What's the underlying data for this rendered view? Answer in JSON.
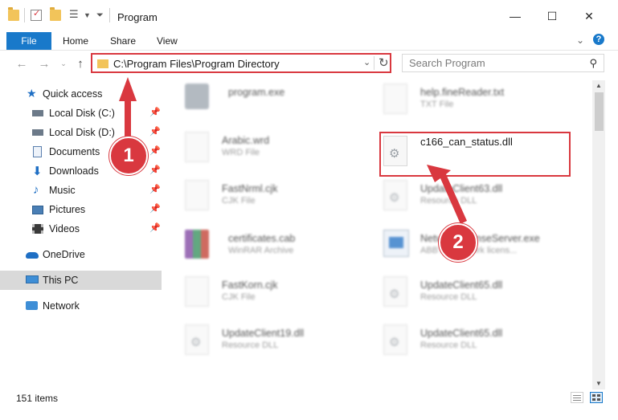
{
  "window": {
    "title": "Program",
    "minimize": "—",
    "maximize": "☐",
    "close": "✕"
  },
  "ribbon": {
    "tabs": [
      "File",
      "Home",
      "Share",
      "View"
    ]
  },
  "address": {
    "path": "C:\\Program Files\\Program Directory",
    "search_placeholder": "Search Program"
  },
  "sidebar": {
    "items": [
      {
        "label": "Quick access",
        "icon": "star-icon",
        "pinned": false
      },
      {
        "label": "Local Disk (C:)",
        "icon": "drive-icon",
        "pinned": true
      },
      {
        "label": "Local Disk (D:)",
        "icon": "drive-icon",
        "pinned": true
      },
      {
        "label": "Documents",
        "icon": "documents-icon",
        "pinned": true
      },
      {
        "label": "Downloads",
        "icon": "download-icon",
        "pinned": true
      },
      {
        "label": "Music",
        "icon": "music-icon",
        "pinned": true
      },
      {
        "label": "Pictures",
        "icon": "pictures-icon",
        "pinned": true
      },
      {
        "label": "Videos",
        "icon": "videos-icon",
        "pinned": true
      },
      {
        "label": "OneDrive",
        "icon": "cloud-icon",
        "pinned": false
      },
      {
        "label": "This PC",
        "icon": "computer-icon",
        "pinned": false,
        "selected": true
      },
      {
        "label": "Network",
        "icon": "network-icon",
        "pinned": false
      }
    ]
  },
  "files": [
    {
      "name": "program.exe",
      "type": "",
      "blurred": true
    },
    {
      "name": "help.fineReader.txt",
      "type": "TXT File",
      "blurred": true
    },
    {
      "name": "Arabic.wrd",
      "type": "WRD File",
      "blurred": true
    },
    {
      "name": "c166_can_status.dll",
      "type": "",
      "blurred": false
    },
    {
      "name": "FastNrml.cjk",
      "type": "CJK File",
      "blurred": true
    },
    {
      "name": "UpdateClient63.dll",
      "type": "Resource DLL",
      "blurred": true
    },
    {
      "name": "certificates.cab",
      "type": "WinRAR Archive",
      "blurred": true
    },
    {
      "name": "NetworkLicenseServer.exe",
      "type": "ABBYY Network licens...",
      "blurred": true
    },
    {
      "name": "FastKorn.cjk",
      "type": "CJK File",
      "blurred": true
    },
    {
      "name": "UpdateClient65.dll",
      "type": "Resource DLL",
      "blurred": true
    },
    {
      "name": "UpdateClient19.dll",
      "type": "Resource DLL",
      "blurred": true
    },
    {
      "name": "UpdateClient65.dll",
      "type": "Resource DLL",
      "blurred": true
    }
  ],
  "status": {
    "items_count": "151 items"
  },
  "annotations": {
    "step1": "1",
    "step2": "2",
    "color": "#d9383f"
  }
}
